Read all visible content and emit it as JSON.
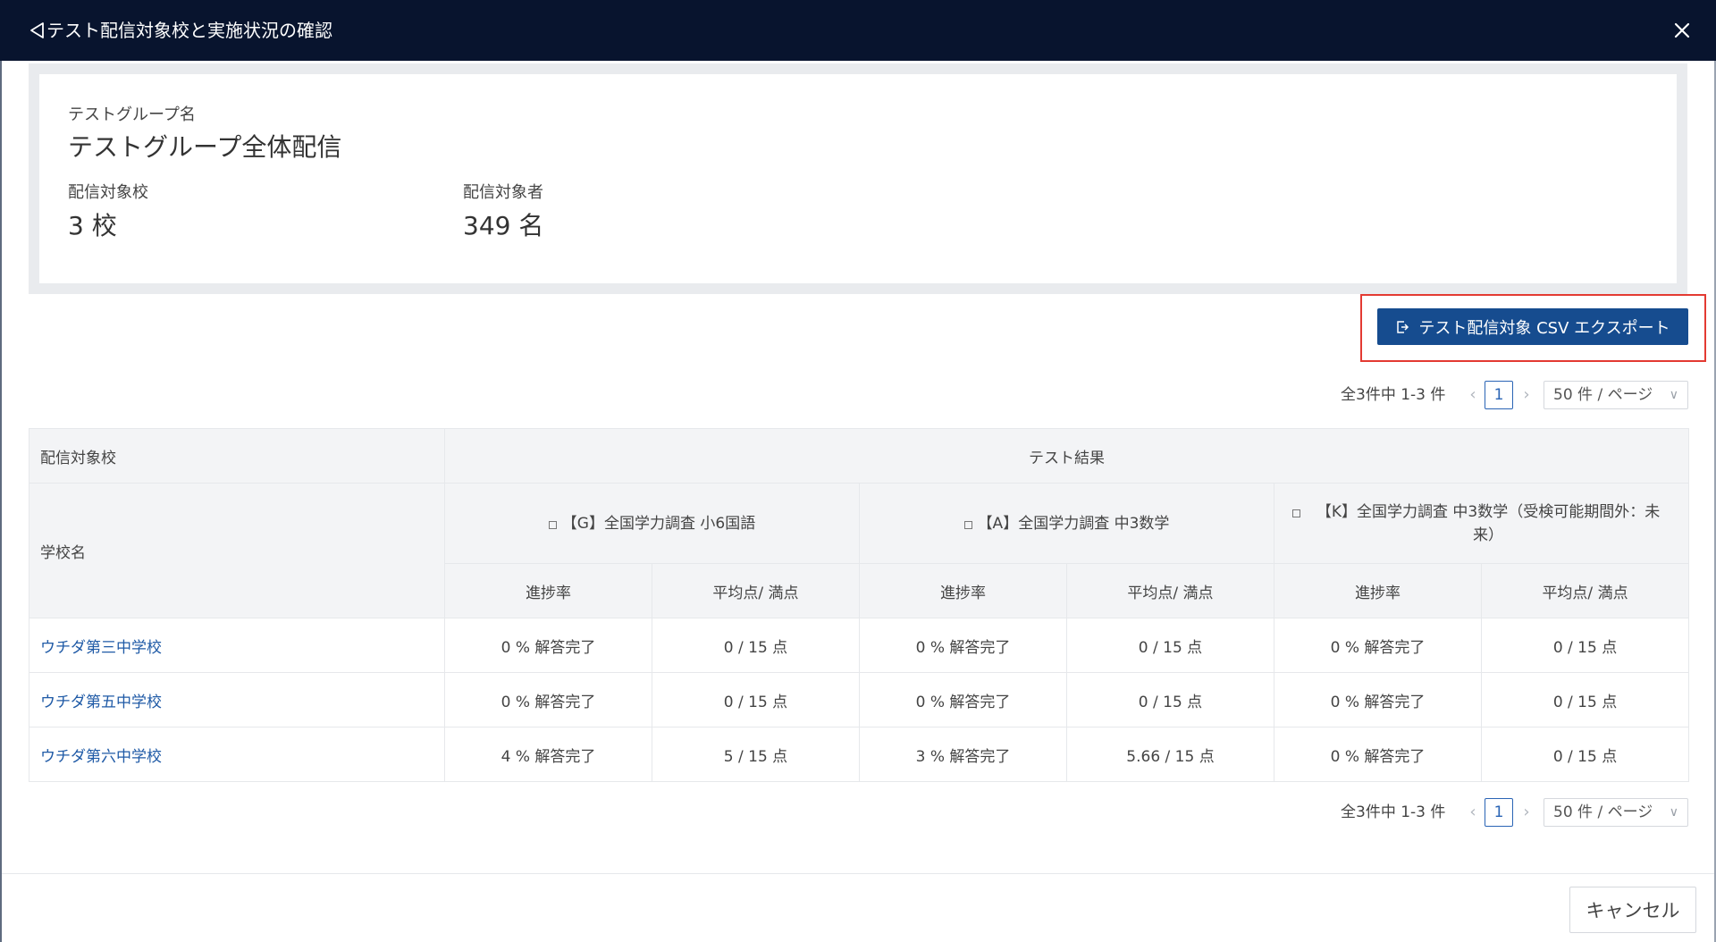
{
  "modal": {
    "title": "テスト配信対象校と実施状況の確認"
  },
  "summary": {
    "group_label": "テストグループ名",
    "group_name": "テストグループ全体配信",
    "schools_label": "配信対象校",
    "schools_value": "3 校",
    "students_label": "配信対象者",
    "students_value": "349 名"
  },
  "export": {
    "label": "テスト配信対象 CSV エクスポート"
  },
  "pagination": {
    "summary": "全3件中 1-3 件",
    "current_page": "1",
    "page_size": "50 件 / ページ"
  },
  "table": {
    "group_header_left": "配信対象校",
    "group_header_right": "テスト結果",
    "school_col_header": "学校名",
    "tests": [
      {
        "name": "【G】全国学力調査 小6国語"
      },
      {
        "name": "【A】全国学力調査 中3数学"
      },
      {
        "name": "【K】全国学力調査 中3数学（受検可能期間外：未来）"
      }
    ],
    "sub_headers": {
      "progress": "進捗率",
      "average": "平均点/ 満点"
    },
    "rows": [
      {
        "school": "ウチダ第三中学校",
        "cells": [
          "0 % 解答完了",
          "0 / 15 点",
          "0 % 解答完了",
          "0 / 15 点",
          "0 % 解答完了",
          "0 / 15 点"
        ]
      },
      {
        "school": "ウチダ第五中学校",
        "cells": [
          "0 % 解答完了",
          "0 / 15 点",
          "0 % 解答完了",
          "0 / 15 点",
          "0 % 解答完了",
          "0 / 15 点"
        ]
      },
      {
        "school": "ウチダ第六中学校",
        "cells": [
          "4 % 解答完了",
          "5 / 15 点",
          "3 % 解答完了",
          "5.66 / 15 点",
          "0 % 解答完了",
          "0 / 15 点"
        ]
      }
    ]
  },
  "footer": {
    "cancel_label": "キャンセル"
  },
  "icons": {
    "back": "back-triangle-icon",
    "close": "close-icon",
    "export": "export-icon",
    "prev": "chevron-left-icon",
    "next": "chevron-right-icon",
    "dropdown": "chevron-down-icon",
    "checkbox": "checkbox-icon"
  },
  "colors": {
    "header_bg": "#08142e",
    "primary": "#164c8f",
    "link": "#1f5aa6",
    "highlight": "#e33a32"
  }
}
